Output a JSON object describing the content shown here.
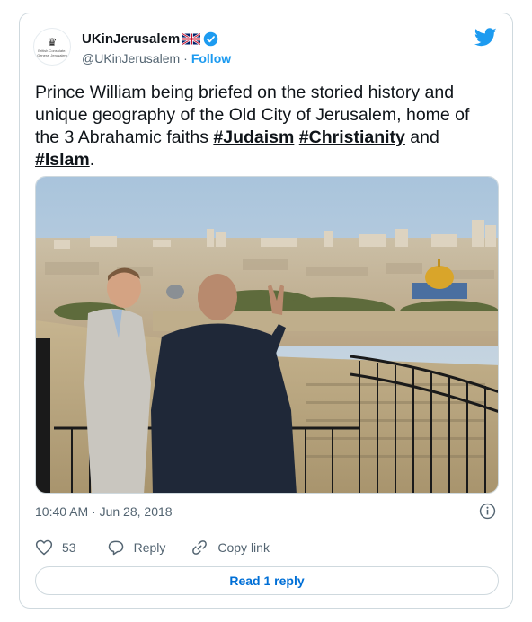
{
  "account": {
    "display_name": "UKinJerusalem",
    "handle": "@UKinJerusalem",
    "separator": "·",
    "follow_label": "Follow",
    "avatar_text": "British Consulate-General Jerusalem"
  },
  "tweet": {
    "text_parts": [
      "Prince William being briefed on the storied history and unique geography of the Old City of Jerusalem, home of the 3 Abrahamic faiths ",
      " ",
      " and ",
      "."
    ],
    "hashtags": [
      "#Judaism",
      "#Christianity",
      "#Islam"
    ],
    "timestamp": "10:40 AM · Jun 28, 2018"
  },
  "actions": {
    "like_count": "53",
    "reply_label": "Reply",
    "copy_link_label": "Copy link",
    "read_replies_label": "Read 1 reply"
  },
  "colors": {
    "accent": "#1d9bf0",
    "link_button": "#006fd6",
    "muted": "#536471"
  }
}
